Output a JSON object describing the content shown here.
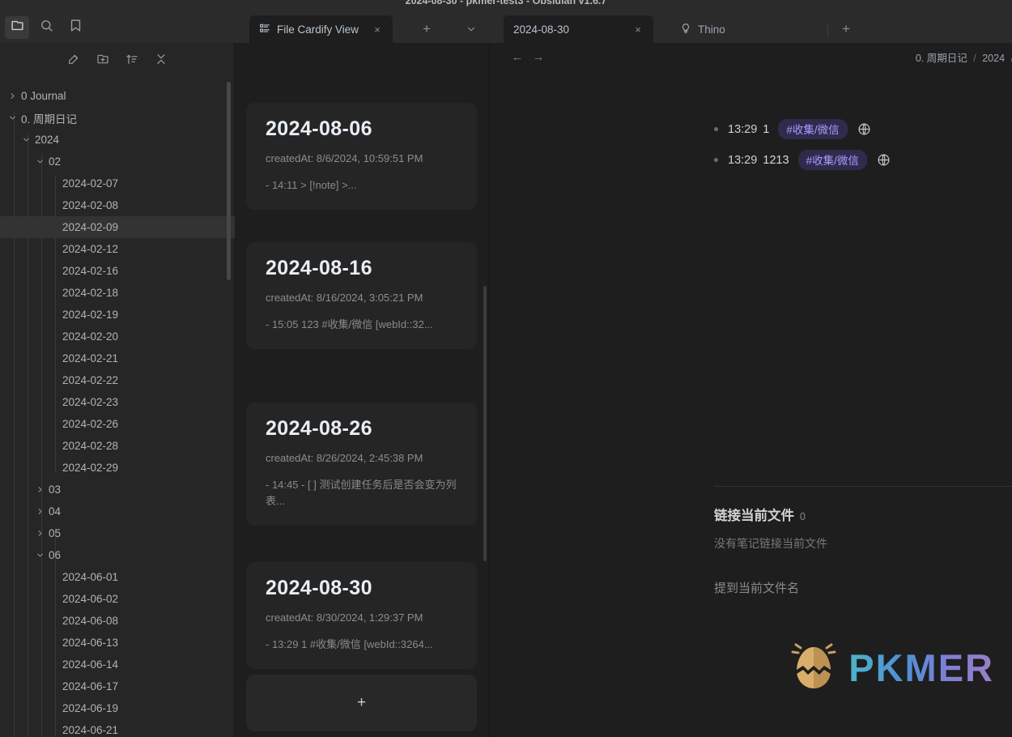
{
  "window": {
    "title": "2024-08-30 - pkmer-test3 - Obsidian v1.6.7"
  },
  "ribbon": {
    "items": [
      {
        "name": "folder-icon",
        "label": "Files",
        "active": true
      },
      {
        "name": "search-icon",
        "label": "Search",
        "active": false
      },
      {
        "name": "bookmark-icon",
        "label": "Bookmarks",
        "active": false
      }
    ]
  },
  "tabs": {
    "left_group": [
      {
        "label": "File Cardify View",
        "icon": "list-layout-icon",
        "active": true,
        "close": "×"
      }
    ],
    "left_new_tab": "+",
    "left_dropdown": "⌄",
    "right_group": [
      {
        "label": "2024-08-30",
        "icon": "",
        "active": true,
        "close": "×"
      },
      {
        "label": "Thino",
        "icon": "lightbulb-icon",
        "active": false,
        "close": ""
      }
    ],
    "right_new_tab": "+"
  },
  "sidebar": {
    "toolbar": [
      {
        "name": "new-note-icon",
        "label": "New note"
      },
      {
        "name": "new-folder-icon",
        "label": "New folder"
      },
      {
        "name": "sort-icon",
        "label": "Change sort order"
      },
      {
        "name": "collapse-all-icon",
        "label": "Collapse all"
      }
    ],
    "tree": [
      {
        "label": "0 Journal",
        "depth": 0,
        "type": "folder",
        "expanded": false,
        "selected": false
      },
      {
        "label": "0. 周期日记",
        "depth": 0,
        "type": "folder",
        "expanded": true,
        "selected": false
      },
      {
        "label": "2024",
        "depth": 1,
        "type": "folder",
        "expanded": true,
        "selected": false
      },
      {
        "label": "02",
        "depth": 2,
        "type": "folder",
        "expanded": true,
        "selected": false
      },
      {
        "label": "2024-02-07",
        "depth": 3,
        "type": "file",
        "selected": false
      },
      {
        "label": "2024-02-08",
        "depth": 3,
        "type": "file",
        "selected": false
      },
      {
        "label": "2024-02-09",
        "depth": 3,
        "type": "file",
        "selected": true
      },
      {
        "label": "2024-02-12",
        "depth": 3,
        "type": "file",
        "selected": false
      },
      {
        "label": "2024-02-16",
        "depth": 3,
        "type": "file",
        "selected": false
      },
      {
        "label": "2024-02-18",
        "depth": 3,
        "type": "file",
        "selected": false
      },
      {
        "label": "2024-02-19",
        "depth": 3,
        "type": "file",
        "selected": false
      },
      {
        "label": "2024-02-20",
        "depth": 3,
        "type": "file",
        "selected": false
      },
      {
        "label": "2024-02-21",
        "depth": 3,
        "type": "file",
        "selected": false
      },
      {
        "label": "2024-02-22",
        "depth": 3,
        "type": "file",
        "selected": false
      },
      {
        "label": "2024-02-23",
        "depth": 3,
        "type": "file",
        "selected": false
      },
      {
        "label": "2024-02-26",
        "depth": 3,
        "type": "file",
        "selected": false
      },
      {
        "label": "2024-02-28",
        "depth": 3,
        "type": "file",
        "selected": false
      },
      {
        "label": "2024-02-29",
        "depth": 3,
        "type": "file",
        "selected": false
      },
      {
        "label": "03",
        "depth": 2,
        "type": "folder",
        "expanded": false,
        "selected": false
      },
      {
        "label": "04",
        "depth": 2,
        "type": "folder",
        "expanded": false,
        "selected": false
      },
      {
        "label": "05",
        "depth": 2,
        "type": "folder",
        "expanded": false,
        "selected": false
      },
      {
        "label": "06",
        "depth": 2,
        "type": "folder",
        "expanded": true,
        "selected": false
      },
      {
        "label": "2024-06-01",
        "depth": 3,
        "type": "file",
        "selected": false
      },
      {
        "label": "2024-06-02",
        "depth": 3,
        "type": "file",
        "selected": false
      },
      {
        "label": "2024-06-08",
        "depth": 3,
        "type": "file",
        "selected": false
      },
      {
        "label": "2024-06-13",
        "depth": 3,
        "type": "file",
        "selected": false
      },
      {
        "label": "2024-06-14",
        "depth": 3,
        "type": "file",
        "selected": false
      },
      {
        "label": "2024-06-17",
        "depth": 3,
        "type": "file",
        "selected": false
      },
      {
        "label": "2024-06-19",
        "depth": 3,
        "type": "file",
        "selected": false
      },
      {
        "label": "2024-06-21",
        "depth": 3,
        "type": "file",
        "selected": false
      }
    ]
  },
  "cards": [
    {
      "title": "2024-08-06",
      "meta": "createdAt: 8/6/2024, 10:59:51 PM",
      "body": "- 14:11 > [!note] >..."
    },
    {
      "title": "2024-08-16",
      "meta": "createdAt: 8/16/2024, 3:05:21 PM",
      "body": "- 15:05 123 #收集/微信 [webId::32..."
    },
    {
      "title": "2024-08-26",
      "meta": "createdAt: 8/26/2024, 2:45:38 PM",
      "body": "- 14:45 - [ ] 测试创建任务后是否会变为列表..."
    },
    {
      "title": "2024-08-30",
      "meta": "createdAt: 8/30/2024, 1:29:37 PM",
      "body": "- 13:29 1 #收集/微信 [webId::3264..."
    }
  ],
  "add_card_button": "+",
  "editor": {
    "back": "←",
    "forward": "→",
    "breadcrumb": [
      "0. 周期日记",
      "2024",
      ""
    ],
    "memos": [
      {
        "time": "13:29",
        "text": "1",
        "tag": "#收集/微信",
        "icon": "globe-icon"
      },
      {
        "time": "13:29",
        "text": "1213",
        "tag": "#收集/微信",
        "icon": "globe-icon"
      }
    ]
  },
  "backlinks": {
    "title": "链接当前文件",
    "count": "0",
    "empty": "没有笔记链接当前文件",
    "mentions": "提到当前文件名"
  },
  "watermark": {
    "text": "PKMER"
  },
  "colors": {
    "accent_tag_bg": "#2f2b4d",
    "accent_tag_text": "#a79dfd",
    "app_bg": "#1e1e1e",
    "sidebar_bg": "#262626",
    "titlebar_bg": "#2b2b2b"
  }
}
